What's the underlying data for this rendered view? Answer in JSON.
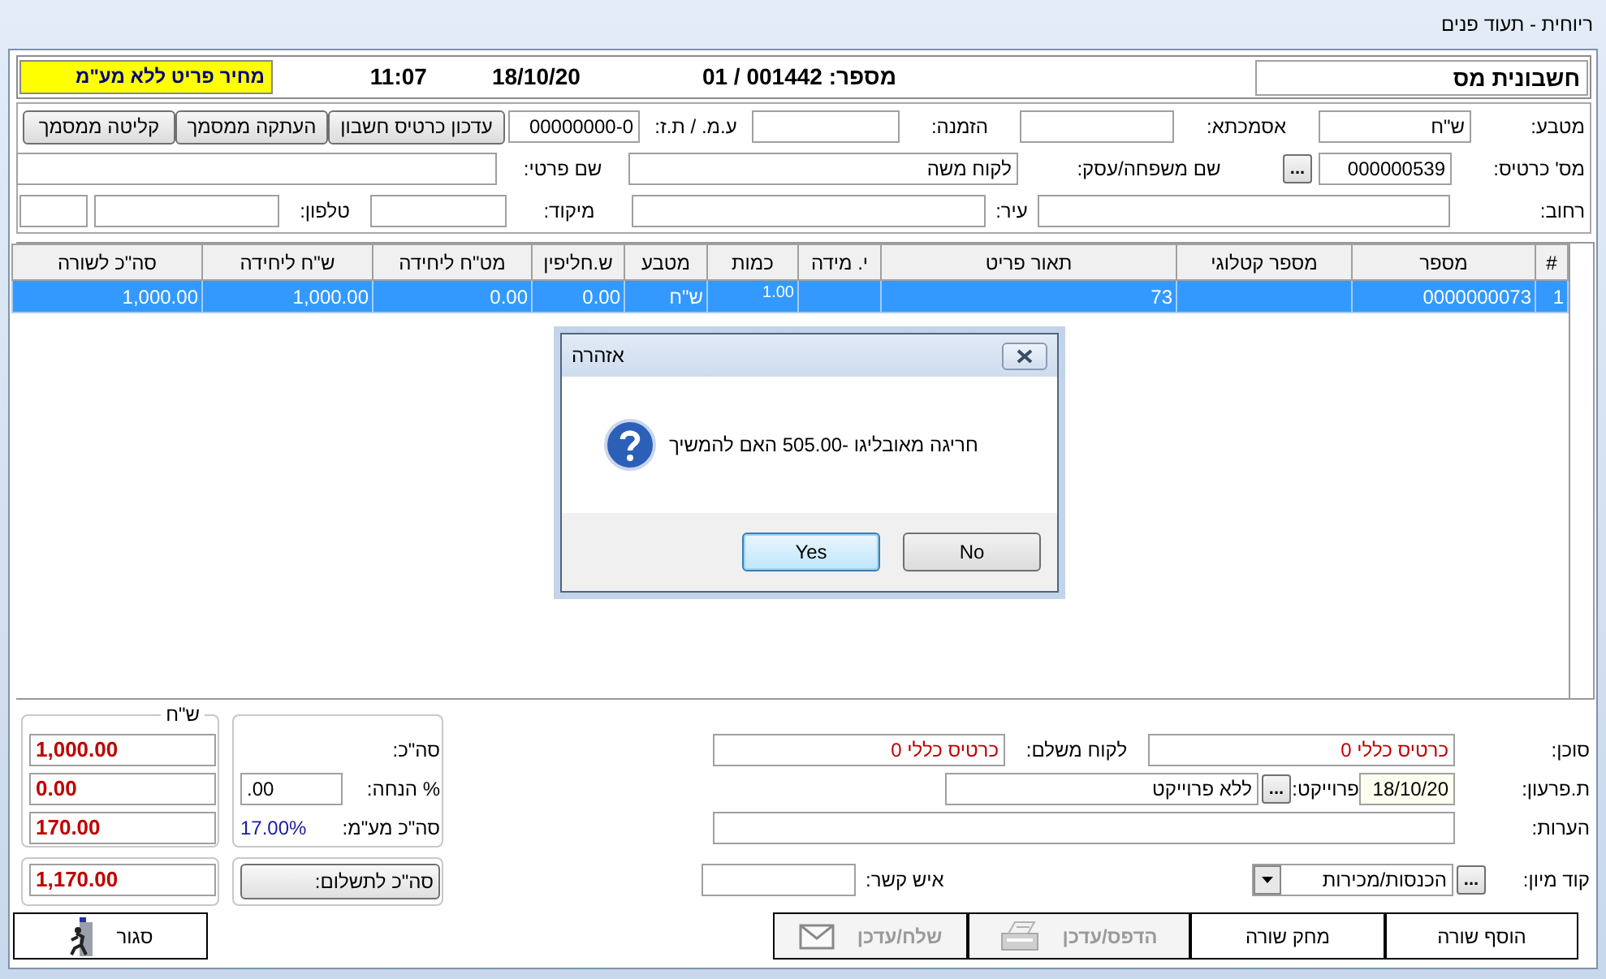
{
  "window": {
    "title": "ריוחית - תעוד פנים"
  },
  "header": {
    "doc_type": "חשבונית מס",
    "number": "מספר: 001442 / 01",
    "date": "18/10/20",
    "time": "11:07",
    "price_note": "מחיר פריט ללא מע\"מ"
  },
  "form": {
    "rows": [
      {
        "items": [
          {
            "kind": "label",
            "text": "מטבע:"
          },
          {
            "kind": "field",
            "value": "ש\"ח"
          },
          {
            "kind": "label",
            "text": "אסמכתא:"
          },
          {
            "kind": "field"
          },
          {
            "kind": "label",
            "text": "הזמנה:"
          },
          {
            "kind": "field"
          },
          {
            "kind": "label",
            "text": "ע.מ. / ת.ז:"
          },
          {
            "kind": "field",
            "value": "00000000-0"
          },
          {
            "kind": "button",
            "text": "עדכון כרטיס חשבון"
          },
          {
            "kind": "button",
            "text": "העתקה ממסמך"
          },
          {
            "kind": "button",
            "text": "קליטה ממסמך"
          }
        ]
      },
      {
        "items": [
          {
            "kind": "label",
            "text": "מס' כרטיס:"
          },
          {
            "kind": "field",
            "value": "000000539"
          },
          {
            "kind": "ellipsis",
            "text": "..."
          },
          {
            "kind": "label",
            "text": "שם משפחה/עסק:"
          },
          {
            "kind": "field",
            "value": "לקוח משה"
          },
          {
            "kind": "label",
            "text": "שם פרטי:"
          },
          {
            "kind": "field"
          }
        ]
      },
      {
        "items": [
          {
            "kind": "label",
            "text": "רחוב:"
          },
          {
            "kind": "field"
          },
          {
            "kind": "label",
            "text": "עיר:"
          },
          {
            "kind": "field"
          },
          {
            "kind": "label",
            "text": "מיקוד:"
          },
          {
            "kind": "field"
          },
          {
            "kind": "label",
            "text": "טלפון:"
          },
          {
            "kind": "field"
          },
          {
            "kind": "field"
          }
        ]
      }
    ]
  },
  "table": {
    "columns": [
      "#",
      "מספר",
      "מספר קטלוגי",
      "תאור פריט",
      "י. מידה",
      "כמות",
      "מטבע",
      "ש.חליפין",
      "מט\"ח ליחידה",
      "ש\"ח ליחידה",
      "סה\"כ לשורה"
    ],
    "rows": [
      {
        "selected": true,
        "cells": [
          "1",
          "0000000073",
          null,
          "73",
          null,
          "1.00",
          "ש\"ח",
          "0.00",
          "0.00",
          "1,000.00",
          "1,000.00"
        ]
      }
    ]
  },
  "totals": {
    "currency": "ש\"ח",
    "rows": [
      {
        "label": "סה\"כ:",
        "amount": "1,000.00"
      },
      {
        "label": "% הנחה:",
        "input": ".00",
        "amount": "0.00"
      },
      {
        "label": "סה\"כ מע\"מ:",
        "rate": "17.00%",
        "amount": "170.00"
      }
    ],
    "grand": {
      "button": "סה\"כ לתשלום:",
      "amount": "1,170.00"
    }
  },
  "details": {
    "rows": [
      {
        "items": [
          {
            "kind": "label",
            "text": "סוכן:"
          },
          {
            "kind": "field",
            "value": "כרטיס כללי 0",
            "warning": true
          },
          {
            "kind": "label",
            "text": "לקוח משלם:"
          },
          {
            "kind": "field",
            "value": "כרטיס כללי 0",
            "warning": true
          }
        ]
      },
      {
        "items": [
          {
            "kind": "label",
            "text": "ת.פרעון:"
          },
          {
            "kind": "field",
            "value": "18/10/20",
            "highlighted": true
          },
          {
            "kind": "label",
            "text": "פרוייקט:"
          },
          {
            "kind": "ellipsis",
            "text": "..."
          },
          {
            "kind": "field",
            "value": "ללא פרוייקט"
          }
        ]
      },
      {
        "items": [
          {
            "kind": "label",
            "text": "הערות:"
          },
          {
            "kind": "field"
          }
        ]
      },
      {
        "items": [
          {
            "kind": "label",
            "text": "קוד מיון:"
          },
          {
            "kind": "ellipsis",
            "text": "..."
          },
          {
            "kind": "select",
            "value": "הכנסות/מכירות"
          },
          {
            "kind": "label",
            "text": "איש קשר:"
          },
          {
            "kind": "field"
          }
        ]
      }
    ]
  },
  "buttons": [
    {
      "kind": "plain",
      "label": "הוסף שורה",
      "disabled": false
    },
    {
      "kind": "plain",
      "label": "מחק שורה",
      "disabled": false
    },
    {
      "kind": "print",
      "label": "הדפס/עדכן",
      "disabled": true
    },
    {
      "kind": "send",
      "label": "שלח/עדכן",
      "disabled": true
    },
    {
      "kind": "exit",
      "label": "סגור",
      "disabled": false
    }
  ],
  "dialog": {
    "title": "אזהרה",
    "message": "חריגה מאובליגו -505.00 האם להמשיך",
    "buttons": [
      {
        "label": "No",
        "focused": false
      },
      {
        "label": "Yes",
        "focused": true
      }
    ]
  }
}
